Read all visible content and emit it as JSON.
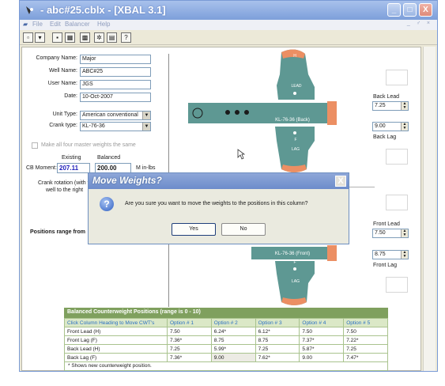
{
  "window": {
    "title": "- abc#25.cblx - [XBAL 3.1]",
    "minimize": "_",
    "maximize": "□",
    "close": "X"
  },
  "menu": {
    "items": [
      "File",
      "Edit",
      "Balancer",
      "Help"
    ],
    "right_controls": "_ ♂ ×"
  },
  "toolbar": {
    "icons": [
      "new-icon",
      "open-icon",
      "save-icon",
      "calculator-icon",
      "image-icon",
      "chart-icon",
      "print-icon",
      "help-icon"
    ],
    "glyphs": [
      "▫",
      "▾",
      "▪",
      "▦",
      "▩",
      "✲",
      "▤",
      "?"
    ]
  },
  "form": {
    "company_label": "Company Name:",
    "company_value": "Major",
    "well_label": "Well Name:",
    "well_value": "ABC#25",
    "user_label": "User Name:",
    "user_value": "JGS",
    "date_label": "Date:",
    "date_value": "10-Oct-2007",
    "unit_type_label": "Unit Type:",
    "unit_type_value": "American conventional",
    "crank_type_label": "Crank type:",
    "crank_type_value": "KL-76-36",
    "make_same_label": "Make all four master weights the same",
    "existing_label": "Existing",
    "balanced_label": "Balanced",
    "cb_moment_label": "CB Moment:",
    "cb_existing": "207.11",
    "cb_balanced": "200.00",
    "cb_units": "M in-lbs",
    "crank_rotation_line1": "Crank rotation (with th",
    "crank_rotation_line2": "well to the right",
    "positions_range_label": "Positions range from"
  },
  "cranks": {
    "back_label": "KL-76-36 (Back)",
    "front_label": "KL-76-36 (Front)",
    "h_label": "H",
    "lead_label": "LEAD",
    "f_label": "F",
    "lag_label": "LAG"
  },
  "side": {
    "back_lead_label": "Back Lead",
    "back_lead_value": "7.25",
    "back_lag_value": "9.00",
    "back_lag_label": "Back Lag",
    "front_lead_label": "Front Lead",
    "front_lead_value": "7.50",
    "front_lag_value": "8.75",
    "front_lag_label": "Front Lag"
  },
  "dialog": {
    "title": "Move Weights?",
    "close": "X",
    "icon": "?",
    "message": "Are you sure you want to move the weights to the positions in this column?",
    "yes": "Yes",
    "no": "No"
  },
  "table": {
    "title": "Balanced Counterweight Positions (range is 0 - 10)",
    "columns": [
      "Click Column Heading to Move CWT's",
      "Option # 1",
      "Option # 2",
      "Option # 3",
      "Option # 4",
      "Option # 5"
    ],
    "rows": [
      [
        "Front Lead (H)",
        "7.50",
        "6.24*",
        "6.12*",
        "7.50",
        "7.50"
      ],
      [
        "Front Lag (F)",
        "7.36*",
        "8.75",
        "8.75",
        "7.37*",
        "7.22*"
      ],
      [
        "Back Lead (H)",
        "7.25",
        "5.99*",
        "7.25",
        "5.87*",
        "7.25"
      ],
      [
        "Back Lag (F)",
        "7.36*",
        "9.00",
        "7.62*",
        "9.00",
        "7.47*"
      ]
    ],
    "footnote": "* Shows new counterweight position."
  },
  "colors": {
    "crank_body": "#5e9893",
    "crank_weight": "#ec8f63",
    "table_header": "#7fa05e"
  }
}
